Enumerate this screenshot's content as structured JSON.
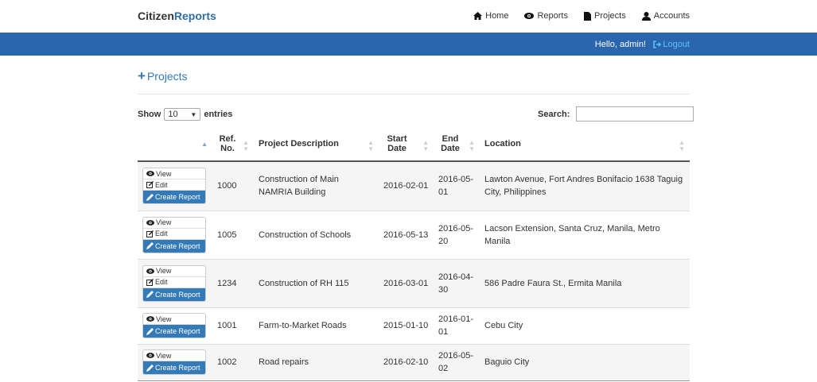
{
  "brand": {
    "part1": "Citizen",
    "part2": "Reports"
  },
  "nav": {
    "home": "Home",
    "reports": "Reports",
    "projects": "Projects",
    "accounts": "Accounts"
  },
  "userbar": {
    "greeting": "Hello, admin!",
    "logout": "Logout"
  },
  "page": {
    "title": "Projects"
  },
  "table_controls": {
    "show_label": "Show",
    "entries_value": "10",
    "entries_label": "entries",
    "search_label": "Search:",
    "search_value": ""
  },
  "columns": {
    "ref": "Ref. No.",
    "description": "Project Description",
    "start": "Start Date",
    "end": "End Date",
    "location": "Location"
  },
  "actions": {
    "view": "View",
    "edit": "Edit",
    "create_report": "Create Report"
  },
  "rows": [
    {
      "ref": "1000",
      "description": "Construction of Main NAMRIA Building",
      "start": "2016-02-01",
      "end": "2016-05-01",
      "location": "Lawton Avenue, Fort Andres Bonifacio 1638 Taguig City, Philippines"
    },
    {
      "ref": "1005",
      "description": "Construction of Schools",
      "start": "2016-05-13",
      "end": "2016-05-20",
      "location": "Lacson Extension, Santa Cruz, Manila, Metro Manila"
    },
    {
      "ref": "1234",
      "description": "Construction of RH 115",
      "start": "2016-03-01",
      "end": "2016-04-30",
      "location": "586 Padre Faura St., Ermita Manila"
    },
    {
      "ref": "1001",
      "description": "Farm-to-Market Roads",
      "start": "2015-01-10",
      "end": "2016-01-01",
      "location": "Cebu City"
    },
    {
      "ref": "1002",
      "description": "Road repairs",
      "start": "2016-02-10",
      "end": "2016-05-02",
      "location": "Baguio City"
    }
  ],
  "colors": {
    "accent": "#2a66ae",
    "primary_button": "#337ab7",
    "logout": "#5bc0f8"
  }
}
